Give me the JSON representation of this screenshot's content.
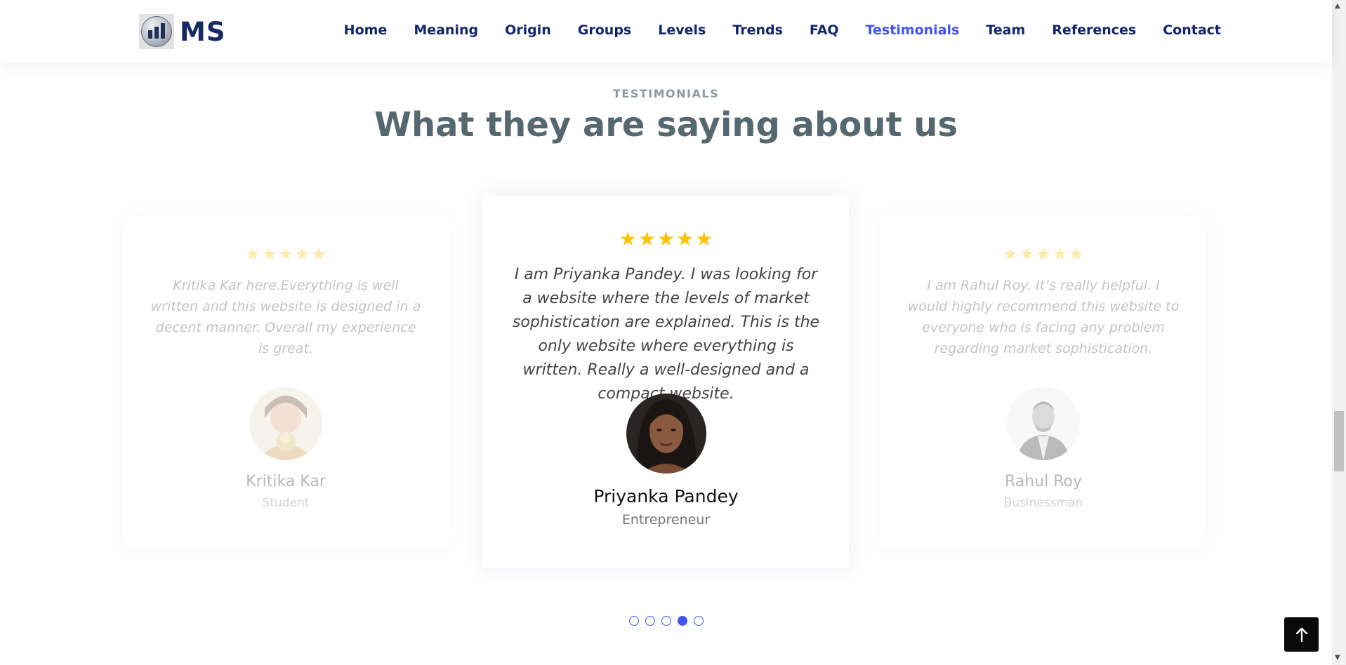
{
  "brand": {
    "name": "MS"
  },
  "nav": {
    "items": [
      "Home",
      "Meaning",
      "Origin",
      "Groups",
      "Levels",
      "Trends",
      "FAQ",
      "Testimonials",
      "Team",
      "References",
      "Contact"
    ],
    "active": "Testimonials"
  },
  "section": {
    "eyebrow": "TESTIMONIALS",
    "title": "What they are saying about us"
  },
  "testimonials": [
    {
      "rating": 5,
      "quote": "Kritika Kar here.Everything is well written and this website is designed in a decent manner. Overall my experience is great.",
      "name": "Kritika Kar",
      "role": "Student"
    },
    {
      "rating": 5,
      "quote": "I am Priyanka Pandey. I was looking for a website where the levels of market sophistication are explained. This is the only website where everything is written. Really a well-designed and a compact website.",
      "name": "Priyanka Pandey",
      "role": "Entrepreneur"
    },
    {
      "rating": 5,
      "quote": "I am Rahul Roy. It’s really helpful. I would highly recommend this website to everyone who is facing any problem regarding market sophistication.",
      "name": "Rahul Roy",
      "role": "Businessman"
    }
  ],
  "carousel": {
    "total_slides": 5,
    "active_index": 4
  },
  "icons": {
    "star": "star-icon",
    "back_to_top": "arrow-up-icon"
  },
  "colors": {
    "accent": "#4154f1",
    "nav": "#13266b",
    "star": "#ffc107",
    "title": "#556870"
  }
}
